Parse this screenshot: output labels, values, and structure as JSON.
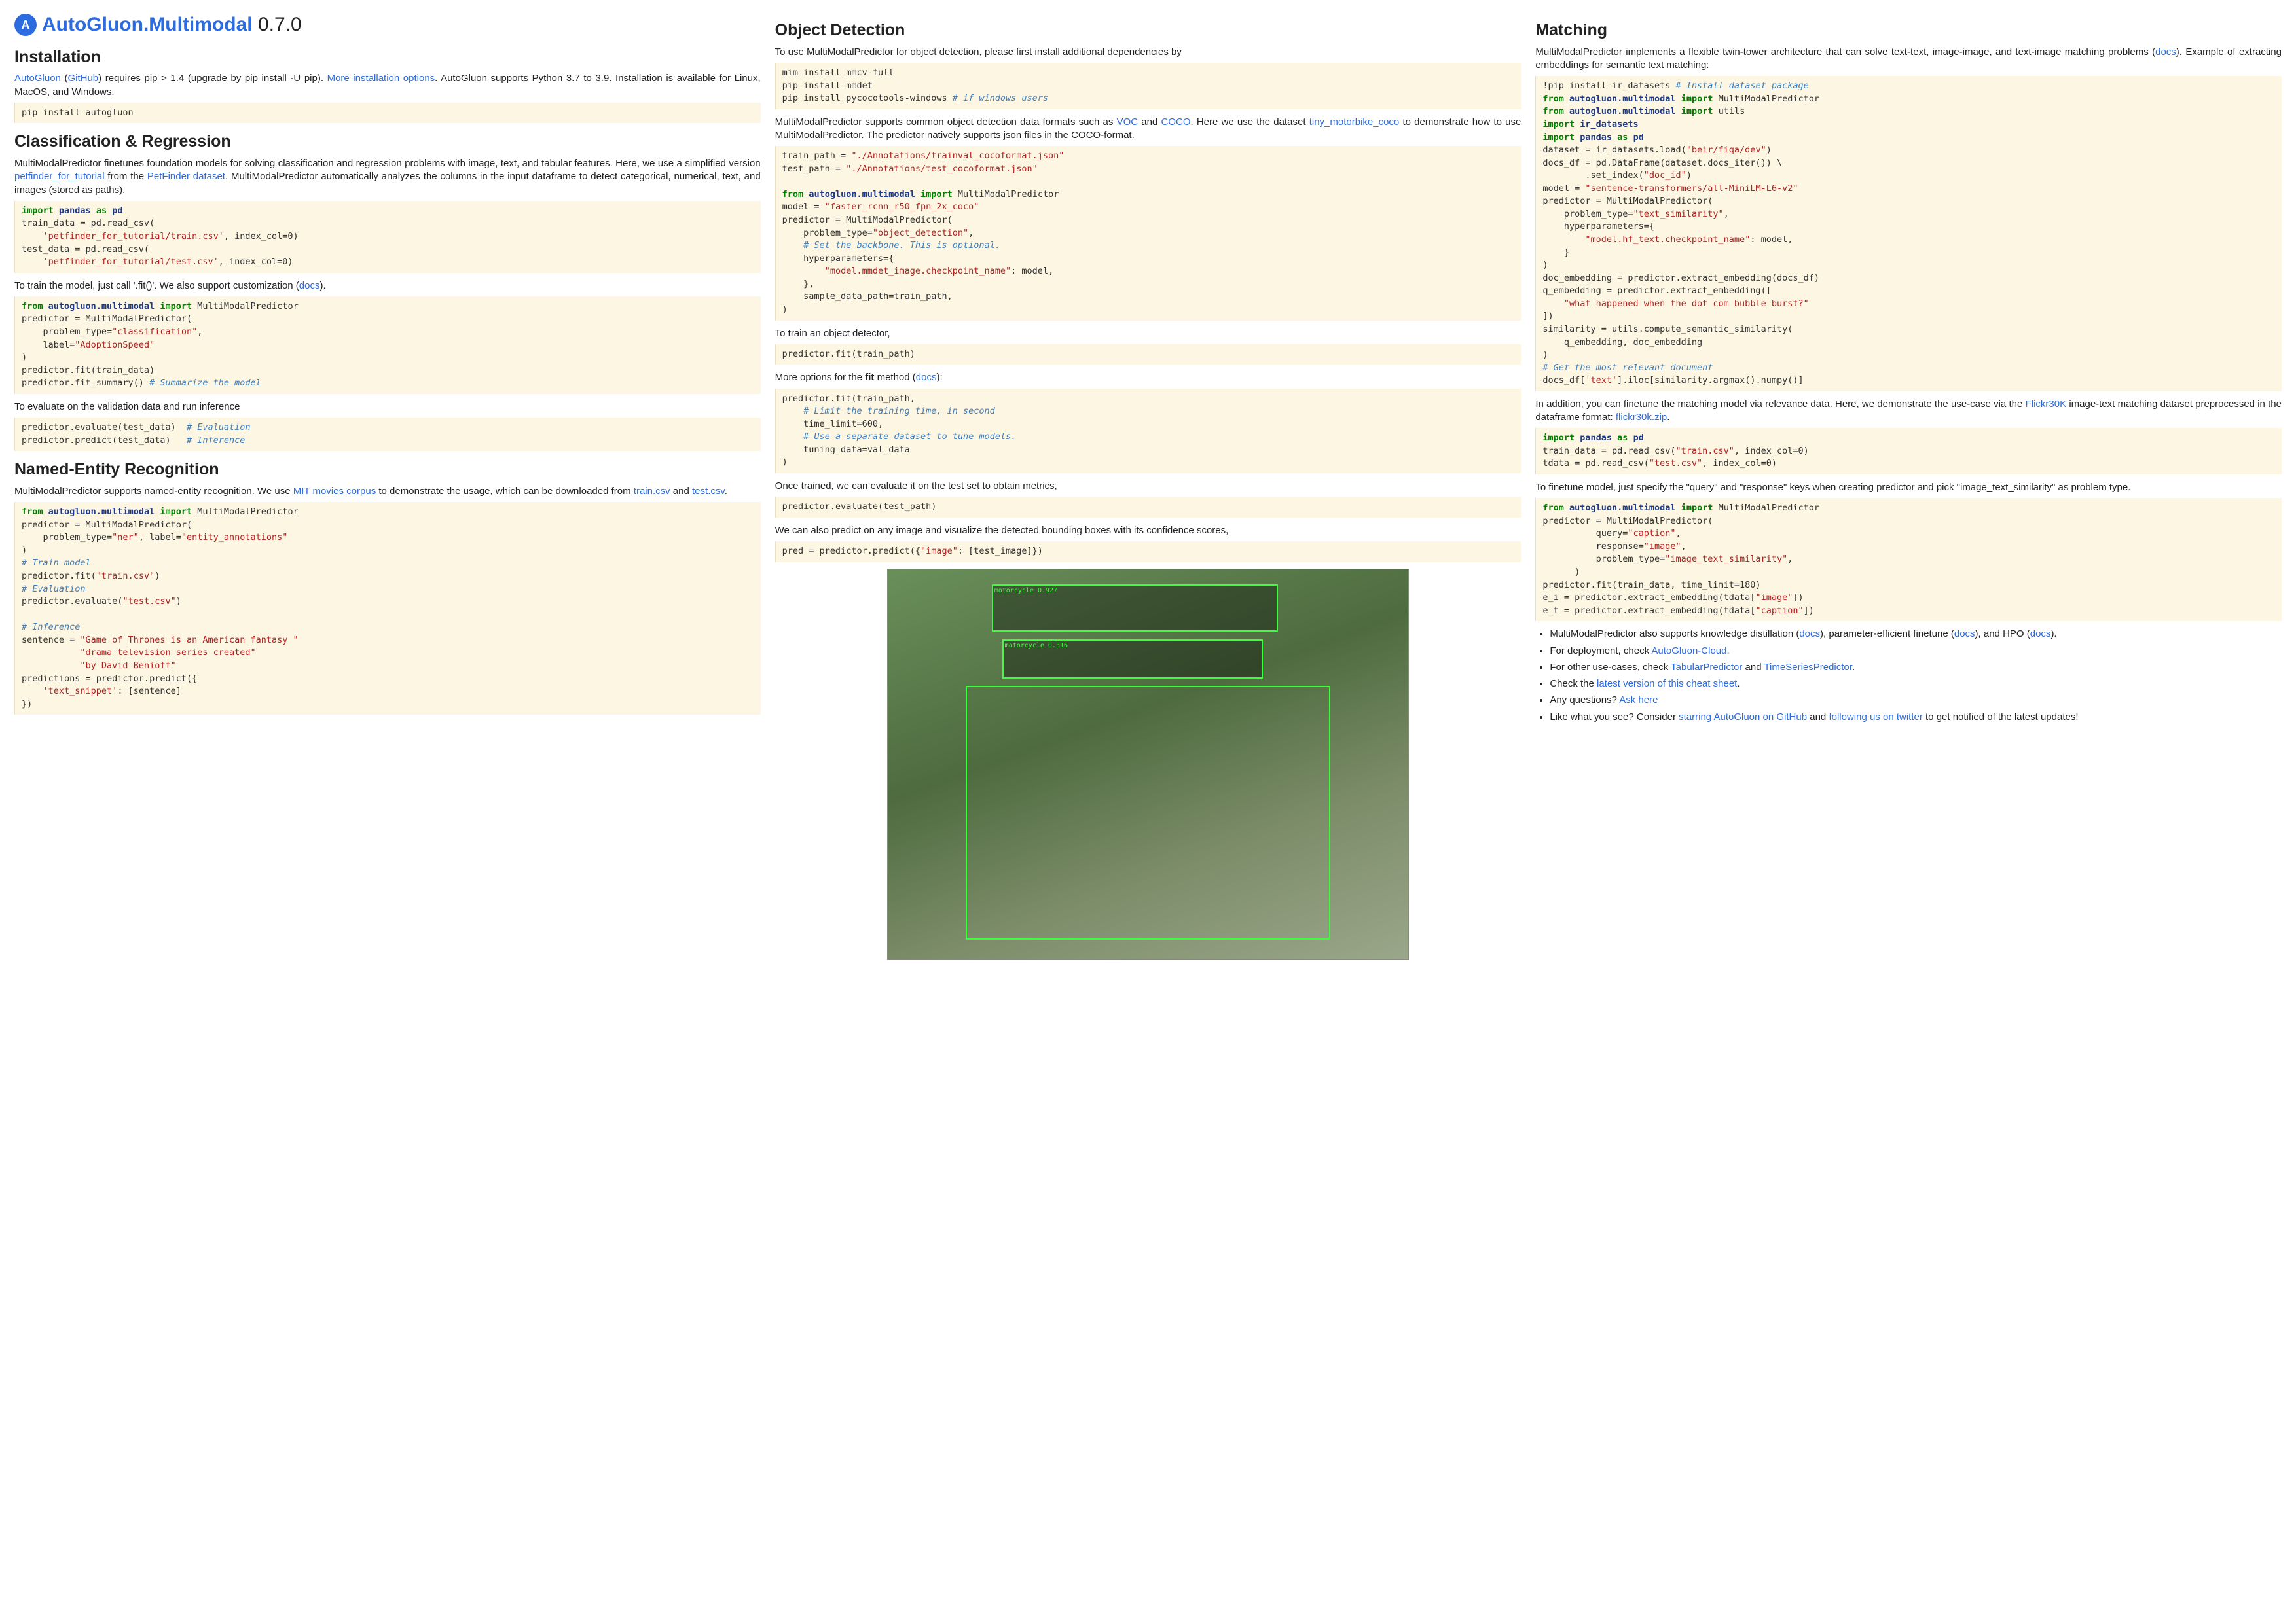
{
  "header": {
    "brand": "AutoGluon.Multimodal",
    "version": "0.7.0"
  },
  "col1": {
    "install_h": "Installation",
    "install_p1a": "AutoGluon",
    "install_p1b": " (",
    "install_p1c": "GitHub",
    "install_p1d": ") requires pip > 1.4 (upgrade by pip install -U pip). ",
    "install_p1e": "More installation options",
    "install_p1f": ".  AutoGluon supports Python 3.7 to 3.9. Installation is available for Linux, MacOS, and Windows.",
    "code_install": "pip install autogluon",
    "cls_h": "Classification & Regression",
    "cls_p1a": "MultiModalPredictor finetunes foundation models for solving classification and regression problems with image, text, and tabular features.  Here, we use a simplified version ",
    "cls_p1b": "petfinder_for_tutorial",
    "cls_p1c": " from the ",
    "cls_p1d": "PetFinder dataset",
    "cls_p1e": ".  MultiModalPredictor automatically analyzes the columns in the input dataframe to detect categorical, numerical, text, and images (stored as paths).",
    "cls_p2a": "To train the model, just call '.fit()'.  We also support customization (",
    "cls_p2b": "docs",
    "cls_p2c": ").",
    "cls_p3": "To evaluate on the validation data and run inference",
    "ner_h": "Named-Entity Recognition",
    "ner_p1a": "MultiModalPredictor supports named-entity recognition.  We use ",
    "ner_p1b": "MIT movies corpus",
    "ner_p1c": " to demonstrate the usage, which can be downloaded from ",
    "ner_p1d": "train.csv",
    "ner_p1e": " and ",
    "ner_p1f": "test.csv",
    "ner_p1g": "."
  },
  "col2": {
    "od_h": "Object Detection",
    "od_p1": "To use MultiModalPredictor for object detection, please first install additional dependencies by",
    "od_p2a": "MultiModalPredictor supports common object detection data formats such as ",
    "od_p2b": "VOC",
    "od_p2c": " and ",
    "od_p2d": "COCO",
    "od_p2e": ". Here we use the dataset ",
    "od_p2f": "tiny_motorbike_coco",
    "od_p2g": " to demonstrate how to use MultiModalPredictor.  The predictor natively supports json files in the COCO-format.",
    "od_p3": "To train an object detector,",
    "od_p4a": "More options for the ",
    "od_p4b": "fit",
    "od_p4c": " method (",
    "od_p4d": "docs",
    "od_p4e": "):",
    "od_p5": "Once trained, we can evaluate it on the test set to obtain metrics,",
    "od_p6": "We can also predict on any image and visualize the detected bounding boxes with its confidence scores,",
    "bbox1": "motorcycle 0.927",
    "bbox2": "motorcycle 0.316"
  },
  "col3": {
    "match_h": "Matching",
    "match_p1a": "MultiModalPredictor implements a flexible twin-tower architecture that can solve text-text, image-image, and text-image matching problems (",
    "match_p1b": "docs",
    "match_p1c": "). Example of extracting embeddings for semantic text matching:",
    "match_p2a": "In addition, you can finetune the matching model via relevance data.  Here, we demonstrate the use-case via the ",
    "match_p2b": "Flickr30K",
    "match_p2c": " image-text matching dataset preprocessed in the dataframe format: ",
    "match_p2d": "flickr30k.zip",
    "match_p2e": ".",
    "match_p3": "To finetune model, just specify the \"query\" and \"response\" keys when creating predictor and pick \"image_text_similarity\" as problem type.",
    "b1a": "MultiModalPredictor also supports knowledge distillation (",
    "b1b": "docs",
    "b1c": "), parameter-efficient finetune (",
    "b1d": "docs",
    "b1e": "), and HPO (",
    "b1f": "docs",
    "b1g": ").",
    "b2a": "For deployment, check ",
    "b2b": "AutoGluon-Cloud",
    "b2c": ".",
    "b3a": "For other use-cases, check ",
    "b3b": "TabularPredictor",
    "b3c": " and ",
    "b3d": "TimeSeriesPredictor",
    "b3e": ".",
    "b4a": "Check the ",
    "b4b": "latest version of this cheat sheet",
    "b4c": ".",
    "b5a": "Any questions? ",
    "b5b": "Ask here",
    "b6a": "Like what you see?  Consider ",
    "b6b": "starring AutoGluon on GitHub",
    "b6c": " and ",
    "b6d": "following us on twitter",
    "b6e": " to get notified of the latest updates!"
  }
}
